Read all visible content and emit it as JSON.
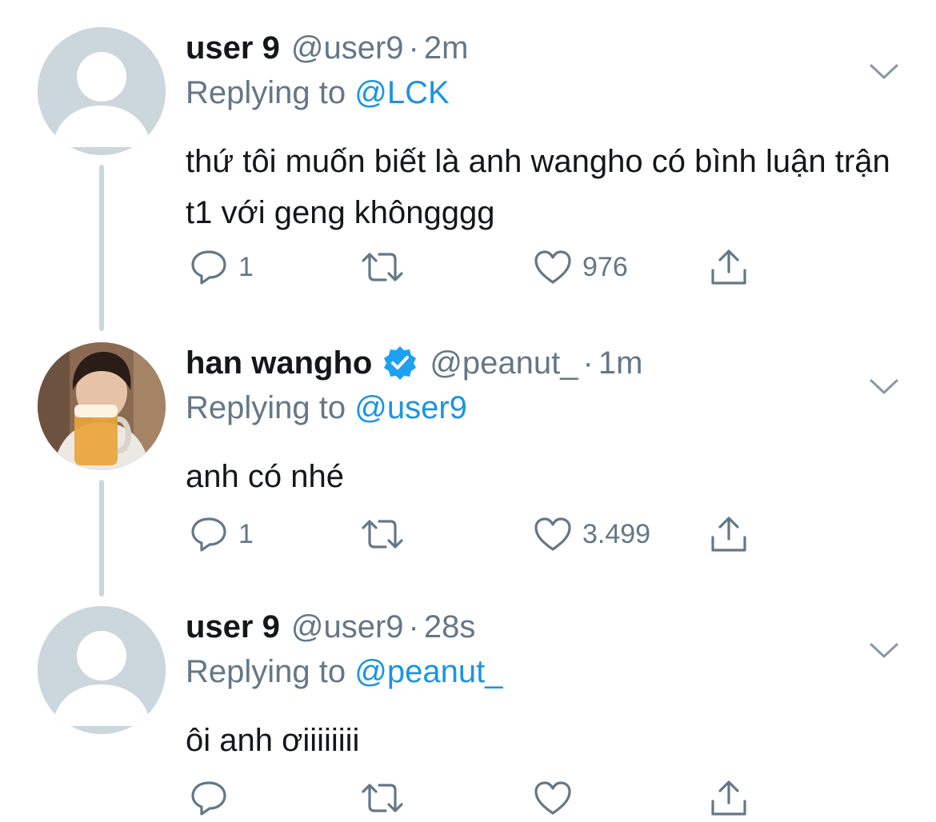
{
  "colors": {
    "text": "#14171a",
    "secondary": "#657786",
    "link": "#1b95e0",
    "thread_line": "#ccd6dd",
    "verified": "#1da1f2"
  },
  "tweets": [
    {
      "display_name": "user 9",
      "handle": "@user9",
      "separator": "·",
      "time": "2m",
      "replying_label": "Replying to",
      "replying_to": "@LCK",
      "text": "thứ tôi muốn biết là anh wangho có bình luận trận t1 với geng khôngggg",
      "reply_count": "1",
      "retweet_count": "",
      "like_count": "976",
      "avatar": "default-avatar-icon",
      "verified": false
    },
    {
      "display_name": "han wangho",
      "handle": "@peanut_",
      "separator": "·",
      "time": "1m",
      "replying_label": "Replying to",
      "replying_to": "@user9",
      "text": "anh có nhé",
      "reply_count": "1",
      "retweet_count": "",
      "like_count": "3.499",
      "avatar": "profile-photo",
      "verified": true
    },
    {
      "display_name": "user 9",
      "handle": "@user9",
      "separator": "·",
      "time": "28s",
      "replying_label": "Replying to",
      "replying_to": "@peanut_",
      "text": "ôi anh ơiiiiiiii",
      "reply_count": "",
      "retweet_count": "",
      "like_count": "",
      "avatar": "default-avatar-icon",
      "verified": false
    }
  ],
  "icons": {
    "reply": "reply-icon",
    "retweet": "retweet-icon",
    "like": "heart-icon",
    "share": "share-icon",
    "more": "chevron-down-icon",
    "verified": "verified-badge-icon"
  }
}
